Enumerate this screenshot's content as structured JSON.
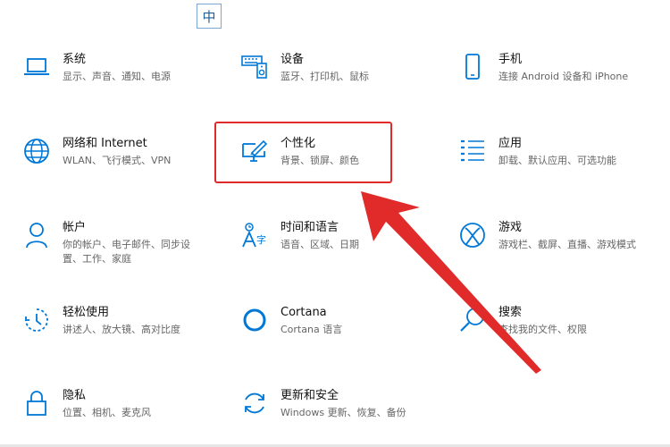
{
  "ime": {
    "label": "中"
  },
  "tiles": {
    "system": {
      "title": "系统",
      "desc": "显示、声音、通知、电源",
      "icon": "laptop-icon"
    },
    "devices": {
      "title": "设备",
      "desc": "蓝牙、打印机、鼠标",
      "icon": "keyboard-speaker-icon"
    },
    "phone": {
      "title": "手机",
      "desc": "连接 Android 设备和 iPhone",
      "icon": "phone-icon"
    },
    "network": {
      "title": "网络和 Internet",
      "desc": "WLAN、飞行模式、VPN",
      "icon": "globe-icon"
    },
    "personalization": {
      "title": "个性化",
      "desc": "背景、锁屏、颜色",
      "icon": "monitor-brush-icon"
    },
    "apps": {
      "title": "应用",
      "desc": "卸载、默认应用、可选功能",
      "icon": "app-list-icon"
    },
    "accounts": {
      "title": "帐户",
      "desc_line1": "你的帐户、电子邮件、同步设",
      "desc_line2": "置、工作、家庭",
      "icon": "person-icon"
    },
    "time_language": {
      "title": "时间和语言",
      "desc": "语音、区域、日期",
      "icon": "language-icon"
    },
    "gaming": {
      "title": "游戏",
      "desc_line1": "游戏栏、截屏、直播、游戏模式",
      "icon": "xbox-icon"
    },
    "ease_of_access": {
      "title": "轻松使用",
      "desc": "讲述人、放大镜、高对比度",
      "icon": "ease-of-access-icon"
    },
    "cortana": {
      "title": "Cortana",
      "desc": "Cortana 语言",
      "icon": "cortana-circle-icon"
    },
    "search": {
      "title": "搜索",
      "desc": "查找我的文件、权限",
      "icon": "search-icon"
    },
    "privacy": {
      "title": "隐私",
      "desc": "位置、相机、麦克风",
      "icon": "lock-icon"
    },
    "update_security": {
      "title": "更新和安全",
      "desc": "Windows 更新、恢复、备份",
      "icon": "sync-icon"
    }
  },
  "colors": {
    "accent": "#0078d7",
    "annotation": "#e12b2b"
  }
}
